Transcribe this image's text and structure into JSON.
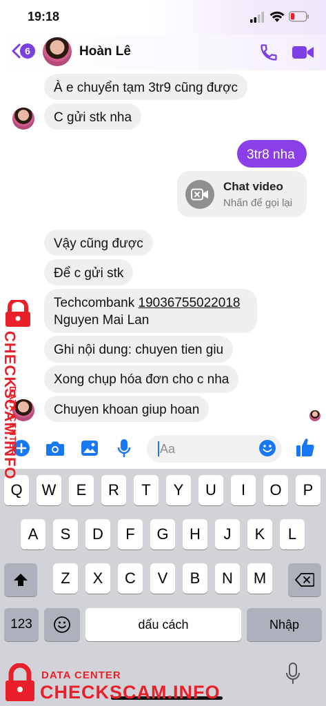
{
  "status_bar": {
    "time": "19:18"
  },
  "header": {
    "back_badge_count": "6",
    "contact_name": "Hoàn Lê"
  },
  "messages": {
    "m1": "À e chuyển tạm 3tr9 cũng được",
    "m2": "C gửi stk nha",
    "m3": "3tr8 nha",
    "call_title": "Chat video",
    "call_subtitle": "Nhấn để gọi lại",
    "m4": "Vậy cũng được",
    "m5": "Để c gửi stk",
    "m6_prefix": "Techcombank ",
    "m6_account": "19036755022018",
    "m6_line2": "Nguyen Mai Lan",
    "m7": "Ghi nội dung: chuyen tien giu",
    "m8": "Xong chụp hóa đơn cho c nha",
    "m9": "Chuyen khoan giup hoan"
  },
  "composer": {
    "placeholder": "Aa"
  },
  "keyboard": {
    "row1": [
      "Q",
      "W",
      "E",
      "R",
      "T",
      "Y",
      "U",
      "I",
      "O",
      "P"
    ],
    "row2": [
      "A",
      "S",
      "D",
      "F",
      "G",
      "H",
      "J",
      "K",
      "L"
    ],
    "row3": [
      "Z",
      "X",
      "C",
      "V",
      "B",
      "N",
      "M"
    ],
    "numbers_key": "123",
    "space_key": "dấu cách",
    "return_key": "Nhập"
  },
  "watermark": {
    "side_top": "DATA CENTER",
    "side_main": "CHECKSCAM.INFO",
    "bottom_top": "DATA CENTER",
    "bottom_main": "CHECKSCAM.INFO"
  },
  "colors": {
    "accent": "#8a3fe8",
    "incoming_bubble": "#efefef",
    "icon_blue": "#1877f2",
    "keyboard_bg": "#d1d3d9",
    "watermark": "#e8202a"
  },
  "icons": [
    "signal-icon",
    "wifi-icon",
    "battery-icon",
    "back-chevron-icon",
    "phone-icon",
    "video-camera-icon",
    "video-call-icon",
    "plus-icon",
    "camera-icon",
    "gallery-icon",
    "microphone-icon",
    "emoji-icon",
    "thumbs-up-icon",
    "shift-icon",
    "backspace-icon",
    "emoji-keyboard-icon",
    "dictation-icon",
    "lock-icon"
  ]
}
